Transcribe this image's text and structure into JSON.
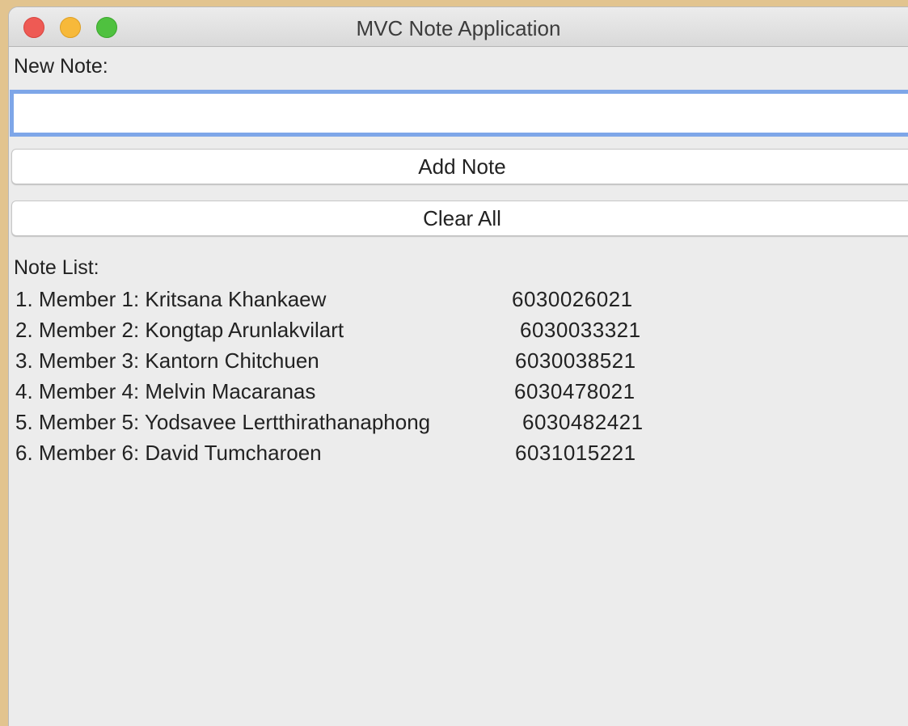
{
  "window": {
    "title": "MVC Note Application"
  },
  "form": {
    "new_note_label": "New Note:",
    "input_value": "",
    "add_button_label": "Add Note",
    "clear_button_label": "Clear All"
  },
  "notes": {
    "label": "Note List:",
    "items": [
      {
        "text": "1. Member 1: Kritsana Khankaew",
        "id": "6030026021"
      },
      {
        "text": "2. Member 2: Kongtap Arunlakvilart",
        "id": "6030033321"
      },
      {
        "text": "3. Member 3: Kantorn Chitchuen",
        "id": "6030038521"
      },
      {
        "text": "4. Member 4: Melvin Macaranas",
        "id": "6030478021"
      },
      {
        "text": "5. Member 5: Yodsavee Lertthirathanaphong",
        "id": "6030482421"
      },
      {
        "text": "6. Member 6: David Tumcharoen",
        "id": "6031015221"
      }
    ]
  },
  "colors": {
    "close": "#ee5a54",
    "minimize": "#f7b93a",
    "maximize": "#4fc13f",
    "focus_ring": "#7ea6e8",
    "desktop": "#e2c48f"
  }
}
